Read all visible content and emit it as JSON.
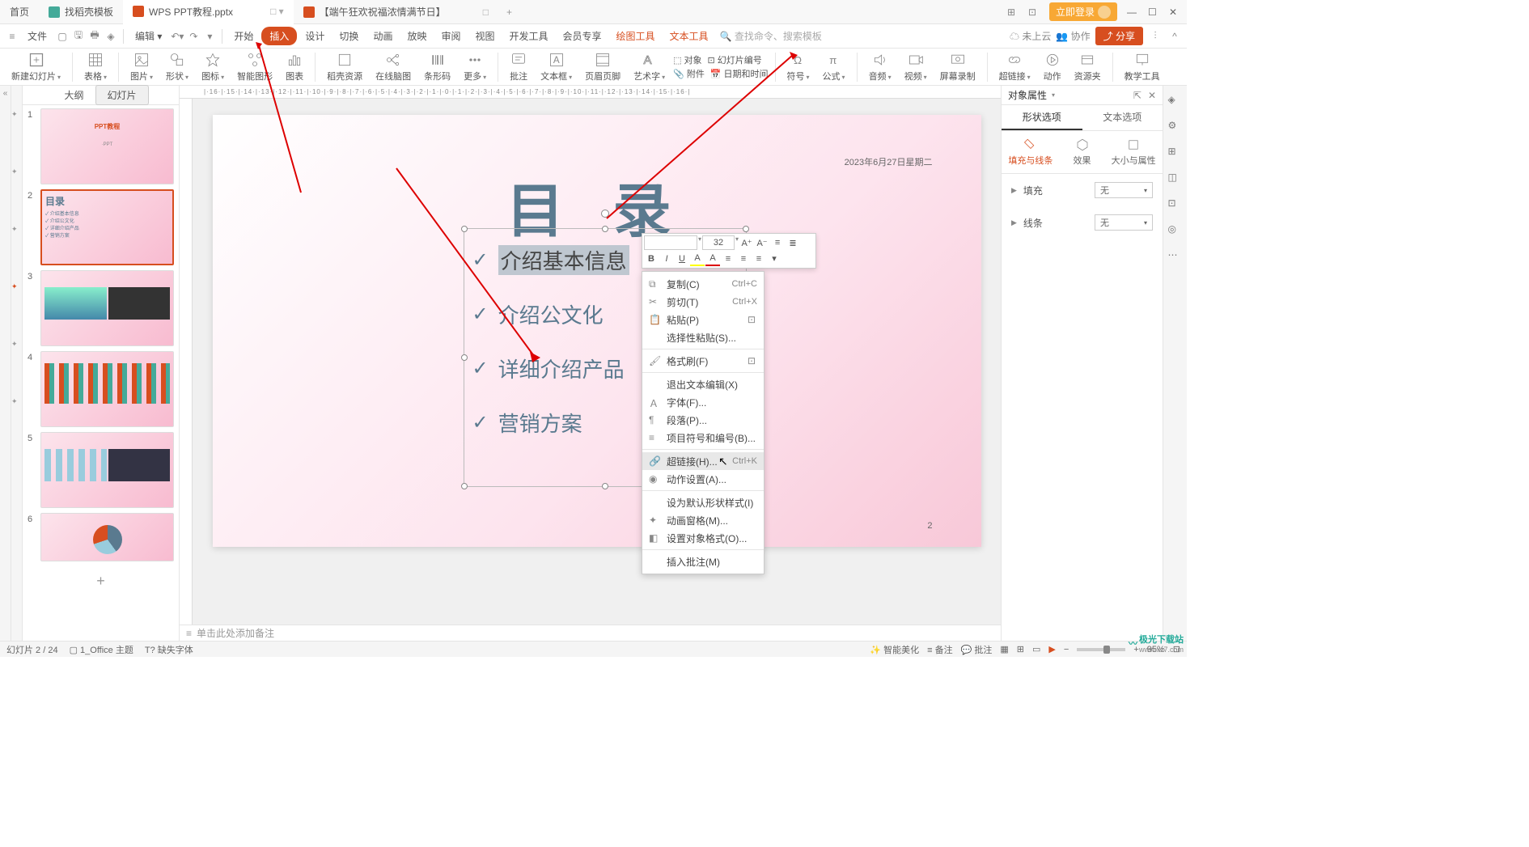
{
  "titlebar": {
    "home": "首页",
    "tabs": [
      {
        "label": "找稻壳模板",
        "icon": "green"
      },
      {
        "label": "WPS PPT教程.pptx",
        "icon": "orange",
        "active": true,
        "meta": "□ ▾"
      },
      {
        "label": "【端午狂欢祝福浓情满节日】",
        "icon": "orange",
        "meta": "□"
      }
    ],
    "login": "立即登录"
  },
  "menubar": {
    "file": "文件",
    "items_left": [
      "三"
    ],
    "quick_icons": [
      "open-icon",
      "save-icon",
      "print-icon",
      "paste-icon",
      "undo",
      "redo",
      "dropdown"
    ],
    "edit": "编辑 ▾",
    "undo_redo": true,
    "tabs": [
      "开始",
      "插入",
      "设计",
      "切换",
      "动画",
      "放映",
      "审阅",
      "视图",
      "开发工具",
      "会员专享"
    ],
    "active_tab": "插入",
    "extra_tabs": [
      "绘图工具",
      "文本工具"
    ],
    "search_placeholder": "查找命令、搜索模板",
    "right": {
      "cloud": "未上云",
      "coop": "协作",
      "share": "分享"
    }
  },
  "ribbon": {
    "items": [
      {
        "label": "新建幻灯片",
        "caret": true
      },
      {
        "label": "表格",
        "caret": true
      },
      {
        "label": "图片",
        "caret": true
      },
      {
        "label": "形状",
        "caret": true
      },
      {
        "label": "图标",
        "caret": true
      },
      {
        "label": "智能图形"
      },
      {
        "label": "图表"
      },
      {
        "label": "稻壳资源"
      },
      {
        "label": "在线脑图"
      },
      {
        "label": "条形码"
      },
      {
        "label": "更多",
        "caret": true
      },
      {
        "label": "批注"
      },
      {
        "label": "文本框",
        "caret": true
      },
      {
        "label": "页眉页脚"
      },
      {
        "label": "艺术字",
        "caret": true
      },
      {
        "label": "附件",
        "inline": true
      },
      {
        "label": "日期和时间",
        "inline": true
      },
      {
        "label": "对象",
        "inline": true
      },
      {
        "label": "幻灯片编号",
        "inline": true
      },
      {
        "label": "符号",
        "caret": true
      },
      {
        "label": "公式",
        "caret": true
      },
      {
        "label": "音频",
        "caret": true
      },
      {
        "label": "视频",
        "caret": true
      },
      {
        "label": "屏幕录制"
      },
      {
        "label": "超链接",
        "caret": true
      },
      {
        "label": "动作"
      },
      {
        "label": "资源夹"
      },
      {
        "label": "教学工具"
      }
    ]
  },
  "slide_panel": {
    "tabs": [
      "大纲",
      "幻灯片"
    ],
    "active_tab": "幻灯片",
    "slides": [
      {
        "num": "1"
      },
      {
        "num": "2",
        "selected": true,
        "title": "目录",
        "items": [
          "✓ 介绍基本信息",
          "✓ 介绍公文化",
          "✓ 详细介绍产品",
          "✓ 营销方案"
        ]
      },
      {
        "num": "3"
      },
      {
        "num": "4"
      },
      {
        "num": "5"
      },
      {
        "num": "6"
      }
    ]
  },
  "canvas": {
    "date": "2023年6月27日星期二",
    "title": "目 录",
    "pagenum": "2",
    "lines": [
      "介绍基本信息",
      "介绍公文化",
      "详细介绍产品",
      "营销方案"
    ]
  },
  "mini_toolbar": {
    "font": "",
    "size": "32",
    "buttons_row1": [
      "A+",
      "A-",
      "list",
      "list2"
    ],
    "buttons_row2": [
      "B",
      "I",
      "U",
      "A▾",
      "A▾",
      "≡",
      "≡",
      "≡",
      "≡"
    ]
  },
  "context_menu": [
    {
      "icon": "copy",
      "label": "复制(C)",
      "shortcut": "Ctrl+C"
    },
    {
      "icon": "cut",
      "label": "剪切(T)",
      "shortcut": "Ctrl+X"
    },
    {
      "icon": "paste",
      "label": "粘贴(P)",
      "right_icon": true
    },
    {
      "icon": "",
      "label": "选择性粘贴(S)..."
    },
    {
      "sep": true
    },
    {
      "icon": "format",
      "label": "格式刷(F)",
      "right_icon": true
    },
    {
      "sep": true
    },
    {
      "icon": "",
      "label": "退出文本编辑(X)"
    },
    {
      "icon": "font",
      "label": "字体(F)..."
    },
    {
      "icon": "para",
      "label": "段落(P)..."
    },
    {
      "icon": "bullet",
      "label": "项目符号和编号(B)..."
    },
    {
      "sep": true
    },
    {
      "icon": "link",
      "label": "超链接(H)...",
      "shortcut": "Ctrl+K",
      "highlighted": true
    },
    {
      "icon": "action",
      "label": "动作设置(A)..."
    },
    {
      "sep": true
    },
    {
      "icon": "",
      "label": "设为默认形状样式(I)"
    },
    {
      "icon": "anim",
      "label": "动画窗格(M)..."
    },
    {
      "icon": "format2",
      "label": "设置对象格式(O)..."
    },
    {
      "sep": true
    },
    {
      "icon": "",
      "label": "插入批注(M)"
    }
  ],
  "right_panel": {
    "title": "对象属性",
    "tabs": [
      "形状选项",
      "文本选项"
    ],
    "active_tab": "形状选项",
    "subtabs": [
      {
        "label": "填充与线条",
        "active": true
      },
      {
        "label": "效果"
      },
      {
        "label": "大小与属性"
      }
    ],
    "sections": [
      {
        "label": "填充",
        "value": "无"
      },
      {
        "label": "线条",
        "value": "无"
      }
    ]
  },
  "notes": {
    "placeholder": "单击此处添加备注"
  },
  "statusbar": {
    "slide_info": "幻灯片 2 / 24",
    "theme": "1_Office 主题",
    "missing_fonts": "缺失字体",
    "smart_beautify": "智能美化",
    "notes": "备注",
    "comments": "批注",
    "zoom": "95%"
  },
  "watermark": {
    "brand": "极光下载站",
    "url": "www.xz7.com"
  }
}
